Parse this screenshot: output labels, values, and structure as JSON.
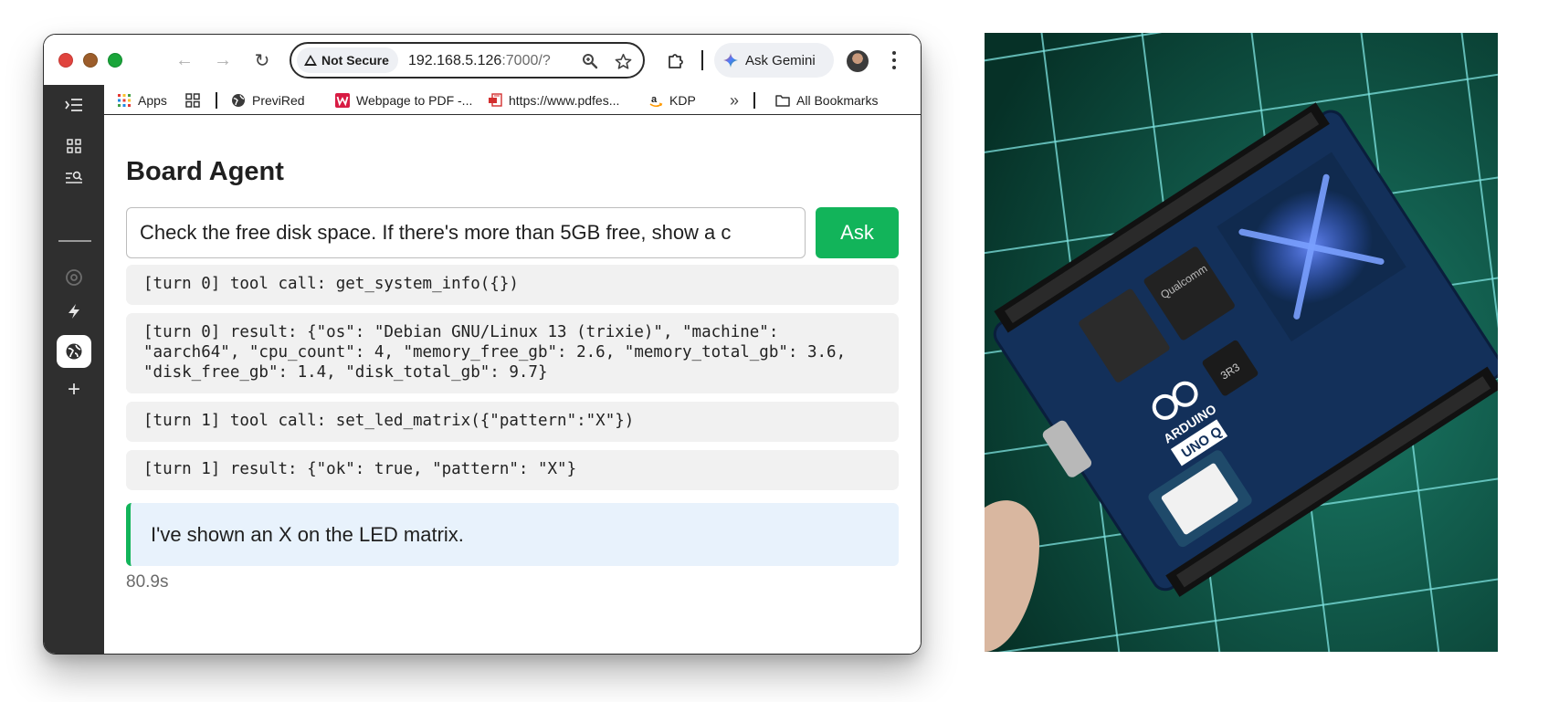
{
  "browser": {
    "nav": {
      "back_glyph": "←",
      "forward_glyph": "→",
      "reload_glyph": "↻"
    },
    "omnibox": {
      "security_label": "Not Secure",
      "url_host": "192.168.5.126",
      "url_rest": ":7000/?",
      "icons": [
        "zoom-icon",
        "star-icon"
      ]
    },
    "gemini_label": "Ask Gemini",
    "colors": {
      "window_border": "#2c2c2c",
      "sidebar_bg": "#2f2f2f"
    }
  },
  "sidebar": {
    "icons": [
      "tab-list-icon",
      "grid-icon",
      "search-list-icon",
      "chrome-icon",
      "bolt-icon",
      "globe-icon",
      "plus-icon"
    ],
    "active": "globe-icon"
  },
  "bookmarks": {
    "items": [
      {
        "label": "Apps",
        "icon": "apps-icon"
      },
      {
        "label": "",
        "icon": "tab-groups-icon"
      },
      {
        "label": "PreviRed",
        "icon": "globe-icon"
      },
      {
        "label": "Webpage to PDF -...",
        "icon": "webtopdf-icon"
      },
      {
        "label": "https://www.pdfes...",
        "icon": "pdf-icon"
      },
      {
        "label": "KDP",
        "icon": "amazon-icon"
      }
    ],
    "overflow_glyph": "»",
    "all_bookmarks": "All Bookmarks"
  },
  "page": {
    "title": "Board Agent",
    "prompt_value": "Check the free disk space. If there's more than 5GB free, show a  c",
    "ask_label": "Ask",
    "log": [
      "[turn 0] tool call: get_system_info({})",
      "[turn 0] result: {\"os\": \"Debian GNU/Linux 13 (trixie)\", \"machine\": \"aarch64\", \"cpu_count\": 4, \"memory_free_gb\": 2.6, \"memory_total_gb\": 3.6, \"disk_free_gb\": 1.4, \"disk_total_gb\": 9.7}",
      "[turn 1] tool call: set_led_matrix({\"pattern\":\"X\"})",
      "[turn 1] result: {\"ok\": true, \"pattern\": \"X\"}"
    ],
    "answer": "I've shown an X on the LED matrix.",
    "elapsed": "80.9s",
    "accent_color": "#12b45a"
  },
  "photo": {
    "board_text": {
      "brand": "ARDUINO",
      "model": "UNO Q",
      "soc": "Qualcomm",
      "inductor": "3R3"
    },
    "colors": {
      "mat": "#0b3d33",
      "board": "#12305a",
      "led": "#3f6dff"
    }
  }
}
